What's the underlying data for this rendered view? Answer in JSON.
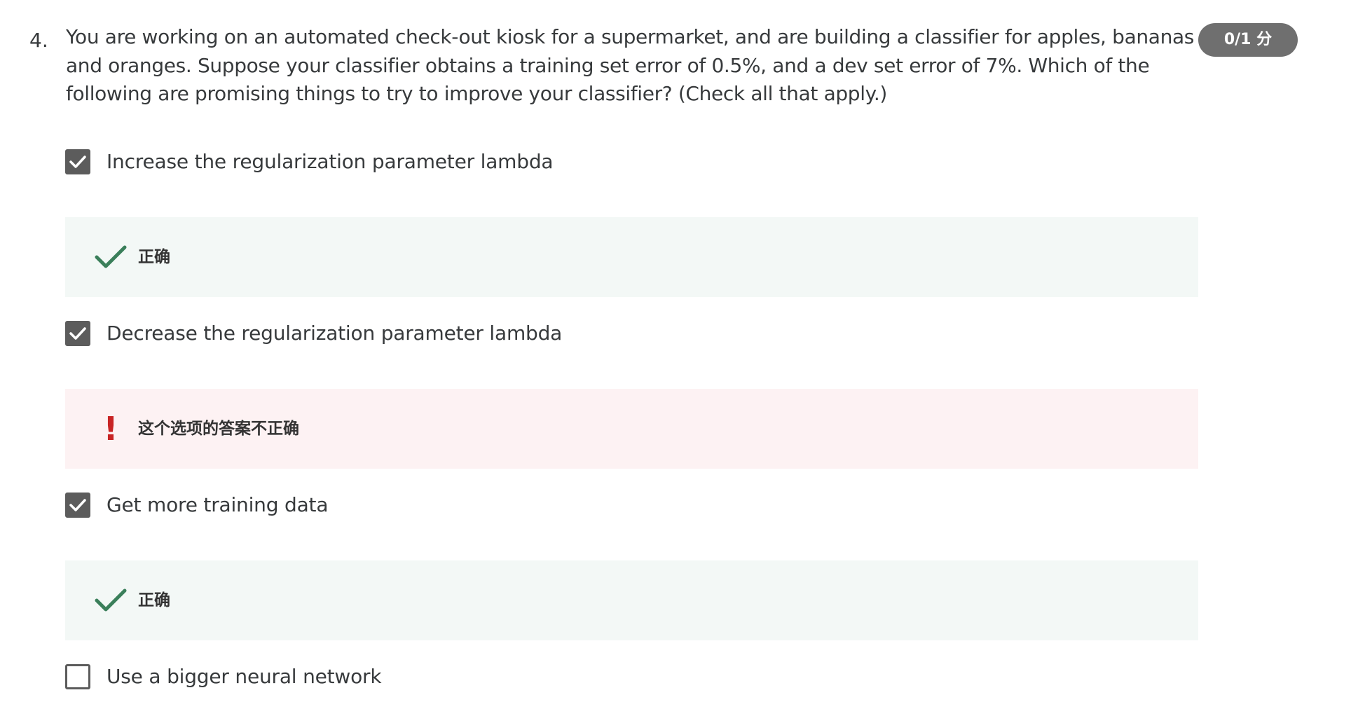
{
  "question": {
    "number": "4.",
    "text": "You are working on an automated check-out kiosk for a supermarket, and are building a classifier for apples, bananas and oranges. Suppose your classifier obtains a training set error of 0.5%, and a dev set error of 7%. Which of the following are promising things to try to improve your classifier? (Check all that apply.)",
    "score": "0/1 分"
  },
  "options": [
    {
      "label": "Increase the regularization parameter lambda",
      "checked": true,
      "feedback": {
        "status": "correct",
        "icon": "checkmark-icon",
        "text": "正确",
        "color": "#3a7f5a"
      }
    },
    {
      "label": "Decrease the regularization parameter lambda",
      "checked": true,
      "feedback": {
        "status": "incorrect",
        "icon": "exclamation-icon",
        "glyph": "!",
        "text": "这个选项的答案不正确",
        "color": "#c82424"
      }
    },
    {
      "label": "Get more training data",
      "checked": true,
      "feedback": {
        "status": "correct",
        "icon": "checkmark-icon",
        "text": "正确",
        "color": "#3a7f5a"
      }
    },
    {
      "label": "Use a bigger neural network",
      "checked": false
    }
  ],
  "colors": {
    "correct_bg": "#f3f8f6",
    "incorrect_bg": "#fdf2f3",
    "badge_bg": "#6f6f6f",
    "checkbox": "#5c5c5c"
  }
}
